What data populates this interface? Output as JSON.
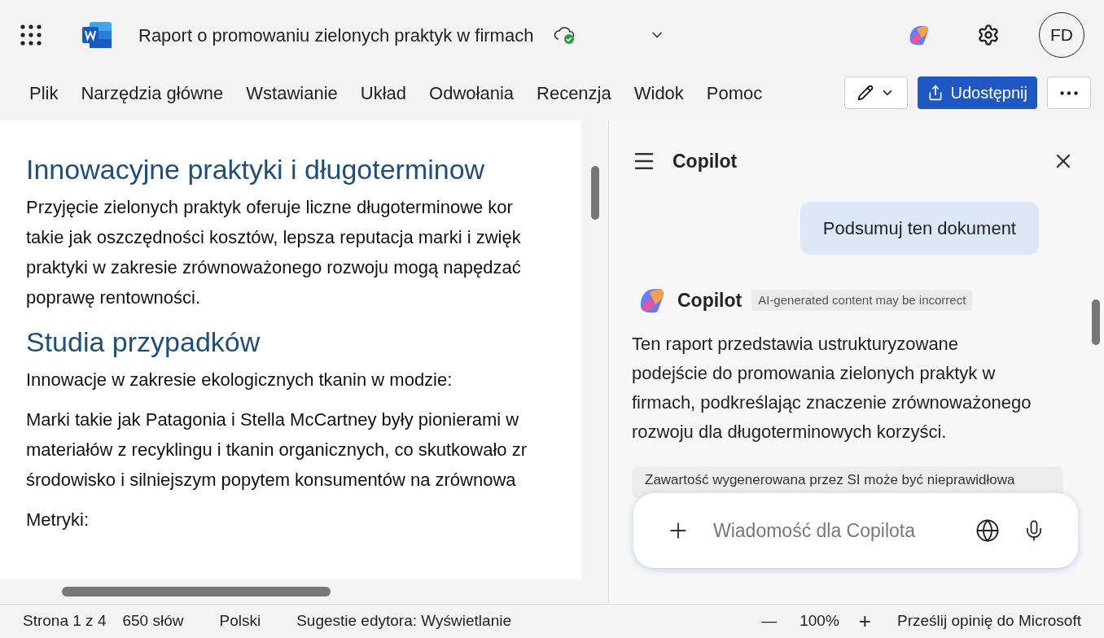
{
  "title_bar": {
    "document_title": "Raport o promowaniu zielonych praktyk w firmach",
    "avatar": "FD"
  },
  "ribbon_tabs": [
    {
      "label": "Plik"
    },
    {
      "label": "Narzędzia główne"
    },
    {
      "label": "Wstawianie"
    },
    {
      "label": "Układ"
    },
    {
      "label": "Odwołania"
    },
    {
      "label": "Recenzja"
    },
    {
      "label": "Widok"
    },
    {
      "label": "Pomoc"
    }
  ],
  "share_button": "Udostępnij",
  "document": {
    "blocks": [
      {
        "kind": "heading",
        "lines": [
          "Innowacyjne praktyki i długoterminow"
        ]
      },
      {
        "kind": "paragraph",
        "lines": [
          "Przyjęcie zielonych praktyk oferuje liczne długoterminowe kor",
          "takie jak oszczędności kosztów, lepsza reputacja marki i zwięk",
          "praktyki w zakresie zrównoważonego rozwoju mogą napędzać",
          "poprawę rentowności."
        ]
      },
      {
        "kind": "heading",
        "lines": [
          "Studia przypadków"
        ]
      },
      {
        "kind": "paragraph",
        "lines": [
          "Innowacje w zakresie ekologicznych tkanin w modzie:"
        ]
      },
      {
        "kind": "paragraph",
        "lines": [
          "Marki takie jak Patagonia i Stella McCartney były pionierami w",
          "materiałów z recyklingu i tkanin organicznych, co skutkowało zr",
          "środowisko i silniejszym popytem konsumentów na zrównowa"
        ]
      },
      {
        "kind": "paragraph",
        "lines": [
          "Metryki:"
        ]
      }
    ]
  },
  "copilot": {
    "title": "Copilot",
    "user_message": "Podsumuj ten dokument",
    "reply_author": "Copilot",
    "reply_badge": "AI-generated content may be incorrect",
    "reply_text": "Ten raport przedstawia ustrukturyzowane podejście do promowania zielonych praktyk w firmach, podkreślając znaczenie zrównoważonego rozwoju dla długoterminowych korzyści.",
    "disclaimer": "Zawartość wygenerowana przez SI może być nieprawidłowa",
    "input_placeholder": "Wiadomość dla Copilota"
  },
  "status_bar": {
    "page": "Strona 1 z 4",
    "words": "650 słów",
    "language": "Polski",
    "editor": "Sugestie edytora: Wyświetlanie",
    "zoom_out": "—",
    "zoom": "100%",
    "zoom_in": "+",
    "feedback": "Prześlij opinię do Microsoft"
  }
}
